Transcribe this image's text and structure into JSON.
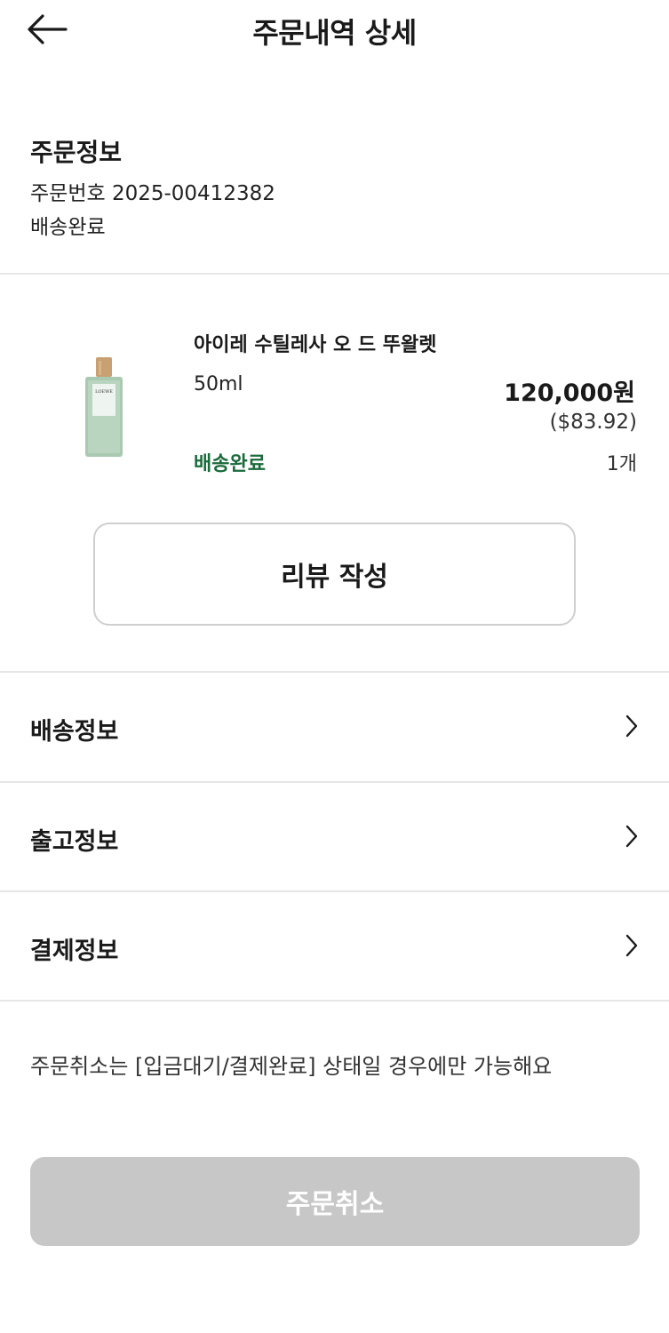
{
  "header": {
    "title": "주문내역 상세",
    "back_icon": "arrow-left-icon"
  },
  "order_info": {
    "section_title": "주문정보",
    "order_number_line": "주문번호 2025-00412382",
    "status": "배송완료"
  },
  "product": {
    "name": "아이레 수틸레사 오 드 뚜왈렛",
    "option": "50ml",
    "price": "120,000원",
    "price_usd": "($83.92)",
    "status": "배송완료",
    "quantity": "1개",
    "status_color": "#1a6b3c",
    "thumb_text": "LOEWE"
  },
  "review_button": {
    "label": "리뷰 작성"
  },
  "sections": [
    {
      "label": "배송정보",
      "icon": "chevron-right-icon"
    },
    {
      "label": "출고정보",
      "icon": "chevron-right-icon"
    },
    {
      "label": "결제정보",
      "icon": "chevron-right-icon"
    }
  ],
  "notice": "주문취소는 [입금대기/결제완료] 상태일 경우에만 가능해요",
  "cancel_button": {
    "label": "주문취소",
    "disabled_color": "#c7c7c7"
  }
}
